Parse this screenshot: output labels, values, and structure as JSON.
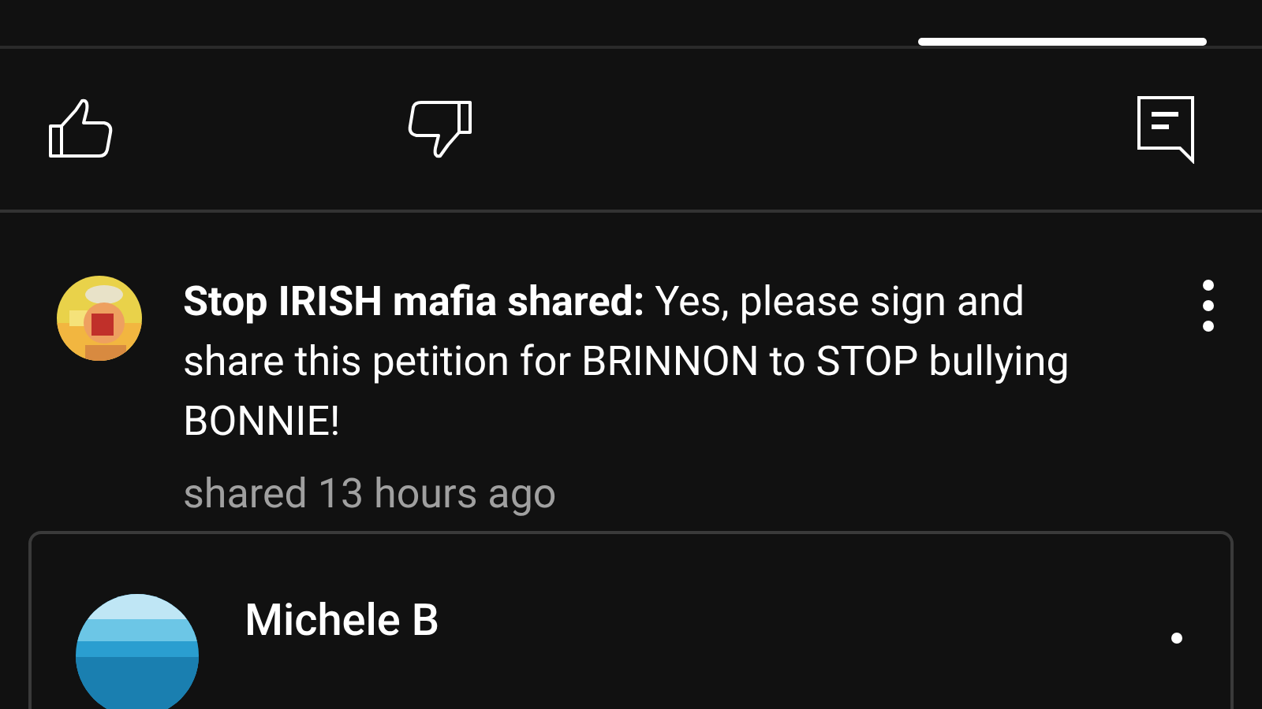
{
  "actions": [
    {
      "kind": "like"
    },
    {
      "kind": "dislike"
    },
    {
      "kind": "comment"
    }
  ],
  "post": {
    "text": "**Stop IRISH mafia shared:** Yes, please sign and share this petition for BRINNON to STOP bullying BONNIE!",
    "time": "shared 13 hours ago"
  },
  "shared_post": {
    "author": "Michele B"
  }
}
